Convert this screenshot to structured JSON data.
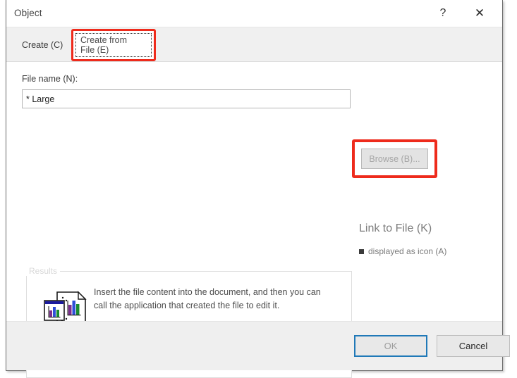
{
  "window": {
    "title": "Object",
    "help_icon": "question-mark-icon",
    "close_icon": "close-icon"
  },
  "tabs": [
    {
      "label": "Create (C)",
      "selected": false
    },
    {
      "label": "Create from\nFile (E)",
      "selected": true,
      "highlighted": true
    }
  ],
  "form": {
    "filename_label": "File name (N):",
    "filename_value": "* Large",
    "filename_placeholder": "",
    "browse_label": "Browse (B)...",
    "browse_disabled": true,
    "browse_highlighted": true
  },
  "options": {
    "link_to_file_label": "Link to File (K)",
    "display_as_icon_label": "displayed as icon (A)",
    "display_as_icon_checked": true
  },
  "results": {
    "legend": "Results",
    "icon": "document-chart-icon",
    "description": "Insert the file content into the document, and then you can call the application that created the file to edit it."
  },
  "footer": {
    "ok_label": "OK",
    "cancel_label": "Cancel",
    "ok_focused": true,
    "ok_disabled": true
  },
  "colors": {
    "annotation_red": "#ee2b1c",
    "focus_blue": "#2079b8",
    "tabstrip_bg": "#f0f0f0",
    "footer_bg": "#efefef",
    "disabled_text": "#a6a6a6"
  }
}
